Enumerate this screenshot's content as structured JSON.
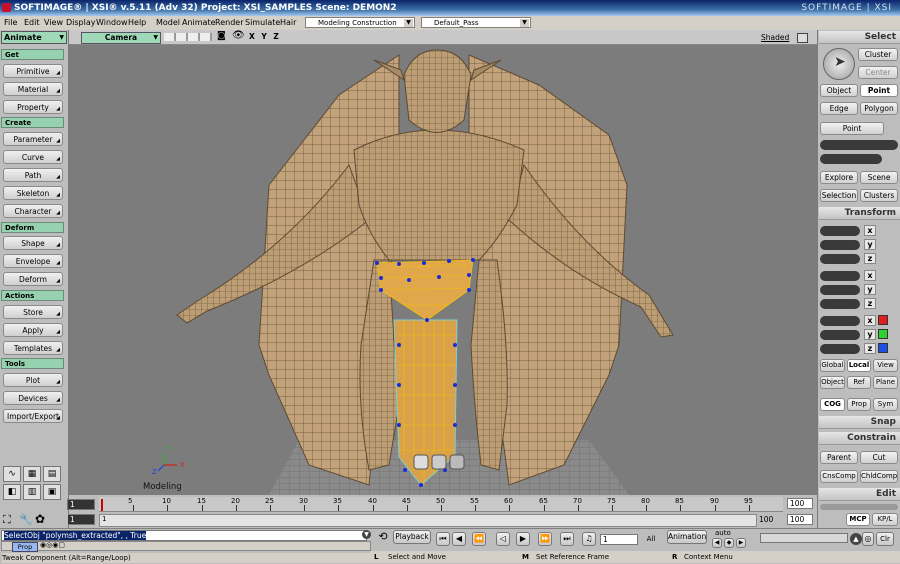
{
  "titlebar": {
    "text": "SOFTIMAGE® | XSI® v.5.11 (Adv 32) Project: XSI_SAMPLES   Scene: DEMON2",
    "brand": "SOFTIMAGE | XSI"
  },
  "menu": {
    "items": [
      "File",
      "Edit",
      "View",
      "Display",
      "Window",
      "Help",
      "Model",
      "Animate",
      "Render",
      "Simulate",
      "Hair"
    ],
    "construction_mode": "Modeling Construction Mode",
    "pass": "Default_Pass"
  },
  "left": {
    "mode": "Animate",
    "sections": {
      "get": "Get",
      "create": "Create",
      "deform": "Deform",
      "actions": "Actions",
      "tools": "Tools"
    },
    "get_buttons": [
      "Primitive",
      "Material",
      "Property"
    ],
    "create_buttons": [
      "Parameter",
      "Curve",
      "Path",
      "Skeleton",
      "Character"
    ],
    "deform_buttons": [
      "Shape",
      "Envelope",
      "Deform"
    ],
    "actions_buttons": [
      "Store",
      "Apply",
      "Templates"
    ],
    "tools_buttons": [
      "Plot",
      "Devices",
      "Import/Export"
    ]
  },
  "viewport": {
    "camera": "Camera",
    "axes": "X Y Z",
    "shading": "Shaded",
    "label": "Modeling",
    "gizmo": {
      "x": "X",
      "y": "Y",
      "z": "Z"
    }
  },
  "timeline": {
    "start": "1",
    "end": "100",
    "end2": "100",
    "current": "1",
    "ticks": [
      "5",
      "10",
      "15",
      "20",
      "25",
      "30",
      "35",
      "40",
      "45",
      "50",
      "55",
      "60",
      "65",
      "70",
      "75",
      "80",
      "85",
      "90",
      "95"
    ],
    "range_start": "1",
    "range_end": "100"
  },
  "right": {
    "select": "Select",
    "cluster": "Cluster",
    "center": "Center",
    "object": "Object",
    "point": "Point",
    "edge": "Edge",
    "polygon": "Polygon",
    "point2": "Point",
    "explore": "Explore",
    "scene": "Scene",
    "selection": "Selection",
    "clusters": "Clusters",
    "transform": "Transform",
    "axes": [
      "x",
      "y",
      "z"
    ],
    "global": "Global",
    "local": "Local",
    "view": "View",
    "object2": "Object",
    "ref": "Ref",
    "plane": "Plane",
    "cog": "COG",
    "prop": "Prop",
    "sym": "Sym",
    "snap": "Snap",
    "constrain": "Constrain",
    "parent": "Parent",
    "cut": "Cut",
    "cnscomp": "CnsComp",
    "childcomp": "ChldComp",
    "edit": "Edit",
    "mcp": "MCP",
    "kpl": "KP/L"
  },
  "bottom": {
    "command": "SelectObj \"polymsh_extracted\", , True",
    "prop": "Prop",
    "playback": "Playback",
    "frame": "1",
    "all": "All",
    "animation": "Animation",
    "auto": "auto",
    "clr": "Clr",
    "status_left": "Tweak Component  (Alt=Range/Loop)",
    "status_l": "L",
    "status_l_text": "Select and Move",
    "status_m": "M",
    "status_m_text": "Set Reference Frame",
    "status_r": "R",
    "status_r_text": "Context Menu"
  },
  "colors": {
    "title": "#0a246a",
    "section": "#96d2b0",
    "viewport_bg": "#7c7c7c",
    "mesh": "#c4a47a",
    "selection": "#e8a000",
    "points": "#1a2bd8"
  }
}
